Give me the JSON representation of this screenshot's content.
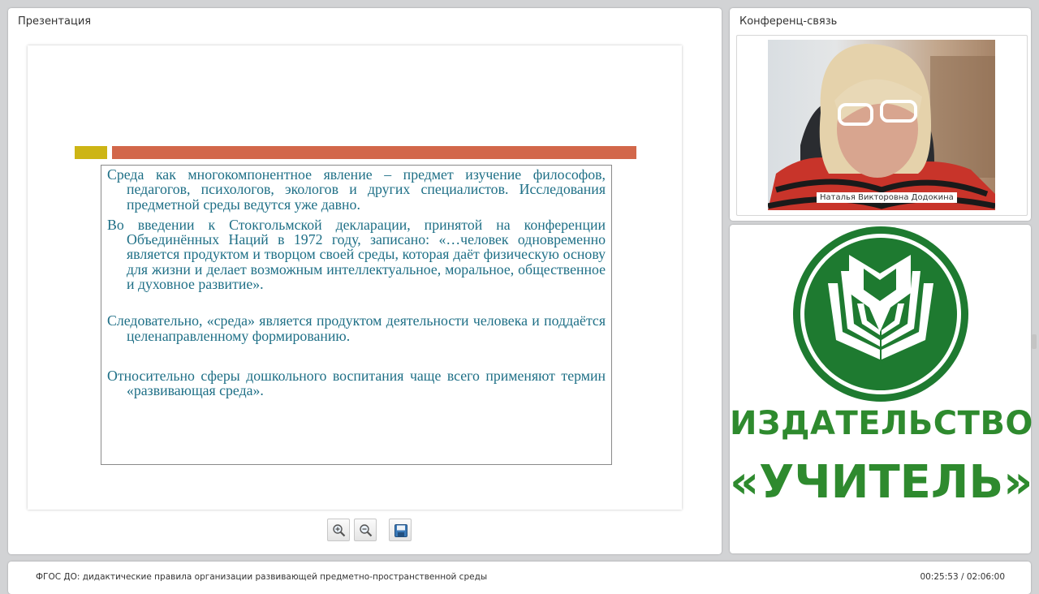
{
  "presentation_panel": {
    "title": "Презентация"
  },
  "slide": {
    "paragraphs": [
      "Среда как многокомпонентное явление – предмет изучение философов, педагогов, психологов, экологов и других специалистов. Исследования предметной среды ведутся уже давно.",
      "Во введении к Стокгольмской декларации, принятой на конференции Объединённых Наций в 1972 году, записано: «…человек одновременно является продуктом и творцом своей среды, которая даёт физическую основу для жизни и делает возможным интеллектуальное, моральное, общественное и духовное развитие».",
      "Следовательно, «среда» является продуктом деятельности человека и поддаётся целенаправленному формированию.",
      "Относительно сферы дошкольного воспитания чаще всего применяют термин «развивающая среда»."
    ]
  },
  "toolbar": {
    "zoom_in_icon": "zoom-in-icon",
    "zoom_out_icon": "zoom-out-icon",
    "save_icon": "save-icon"
  },
  "conference_panel": {
    "title": "Конференц-связь",
    "speaker_name": "Наталья Викторовна Додокина"
  },
  "logo": {
    "line1": "ИЗДАТЕЛЬСТВО",
    "line2": "«УЧИТЕЛЬ»",
    "color": "#1e7a30"
  },
  "footer": {
    "title": "ФГОС ДО: дидактические правила организации развивающей предметно-пространственной среды",
    "time": "00:25:53 / 02:06:00"
  }
}
